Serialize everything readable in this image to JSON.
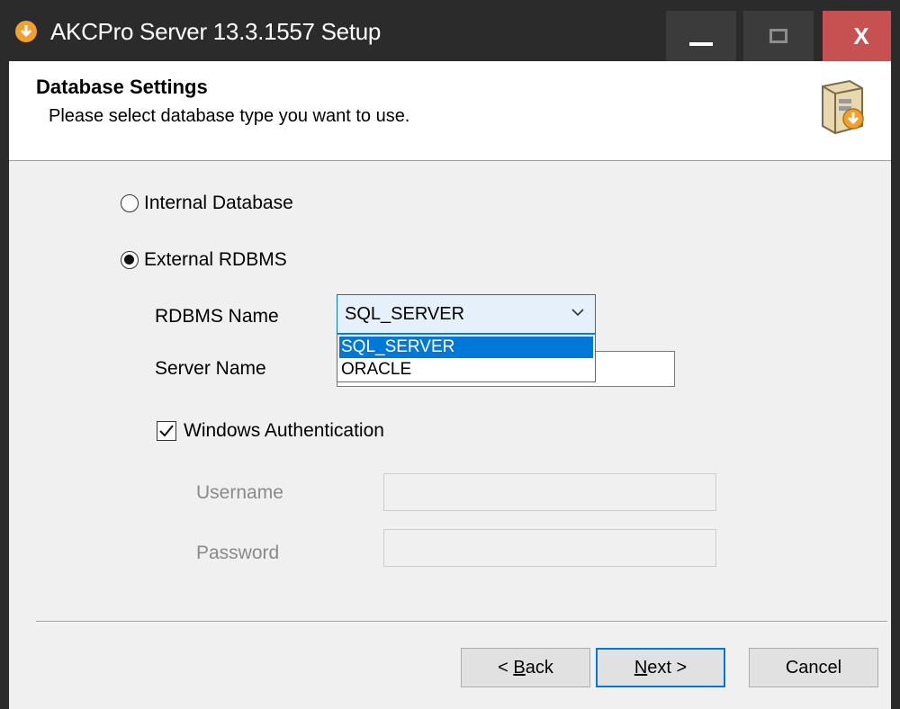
{
  "window": {
    "title": "AKCPro Server 13.3.1557 Setup",
    "close_glyph": "X"
  },
  "header": {
    "title": "Database Settings",
    "subtitle": "Please select database type you want to use."
  },
  "database_type": {
    "internal_label": "Internal Database",
    "external_label": "External RDBMS",
    "selected": "External RDBMS"
  },
  "rdbms": {
    "name_label": "RDBMS Name",
    "selected_value": "SQL_SERVER",
    "options": [
      "SQL_SERVER",
      "ORACLE"
    ],
    "highlighted_option": "SQL_SERVER"
  },
  "server": {
    "label": "Server Name",
    "value": ""
  },
  "auth": {
    "windows_label": "Windows Authentication",
    "windows_checked": true,
    "username_label": "Username",
    "username_value": "",
    "password_label": "Password",
    "password_value": ""
  },
  "buttons": {
    "back_prefix": "< ",
    "back_mnemonic": "B",
    "back_rest": "ack",
    "next_mnemonic": "N",
    "next_rest": "ext >",
    "cancel": "Cancel"
  },
  "colors": {
    "titlebar": "#2b2b2b",
    "close_button": "#c75050",
    "accent": "#0078d7"
  }
}
